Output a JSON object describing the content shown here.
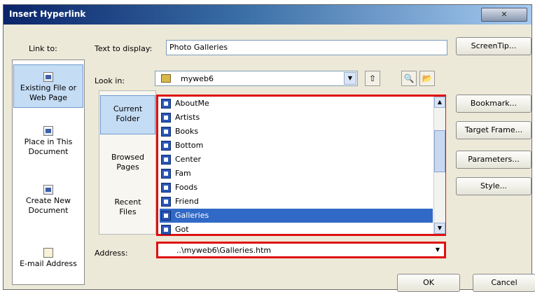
{
  "window": {
    "title": "Insert Hyperlink",
    "close_label": "✕"
  },
  "link_to": {
    "label": "Link to:",
    "items": [
      {
        "label_line1": "Existing File or",
        "label_line2": "Web Page",
        "selected": true
      },
      {
        "label_line1": "Place in This",
        "label_line2": "Document",
        "selected": false
      },
      {
        "label_line1": "Create New",
        "label_line2": "Document",
        "selected": false
      },
      {
        "label_line1": "E-mail Address",
        "label_line2": "",
        "selected": false
      }
    ]
  },
  "text_to_display": {
    "label": "Text to display:",
    "value": "Photo Galleries"
  },
  "look_in": {
    "label": "Look in:",
    "value": "myweb6"
  },
  "views": [
    {
      "line1": "Current",
      "line2": "Folder",
      "selected": true
    },
    {
      "line1": "Browsed",
      "line2": "Pages",
      "selected": false
    },
    {
      "line1": "Recent",
      "line2": "Files",
      "selected": false
    }
  ],
  "files": [
    {
      "name": "AboutMe"
    },
    {
      "name": "Artists"
    },
    {
      "name": "Books"
    },
    {
      "name": "Bottom"
    },
    {
      "name": "Center"
    },
    {
      "name": "Fam"
    },
    {
      "name": "Foods"
    },
    {
      "name": "Friend"
    },
    {
      "name": "Galleries"
    },
    {
      "name": "Got"
    }
  ],
  "selected_file": "Galleries",
  "address": {
    "label": "Address:",
    "value": "..\\myweb6\\Galleries.htm"
  },
  "buttons": {
    "screentip": "ScreenTip...",
    "bookmark": "Bookmark...",
    "target_frame": "Target Frame...",
    "parameters": "Parameters...",
    "style": "Style...",
    "ok": "OK",
    "cancel": "Cancel"
  }
}
